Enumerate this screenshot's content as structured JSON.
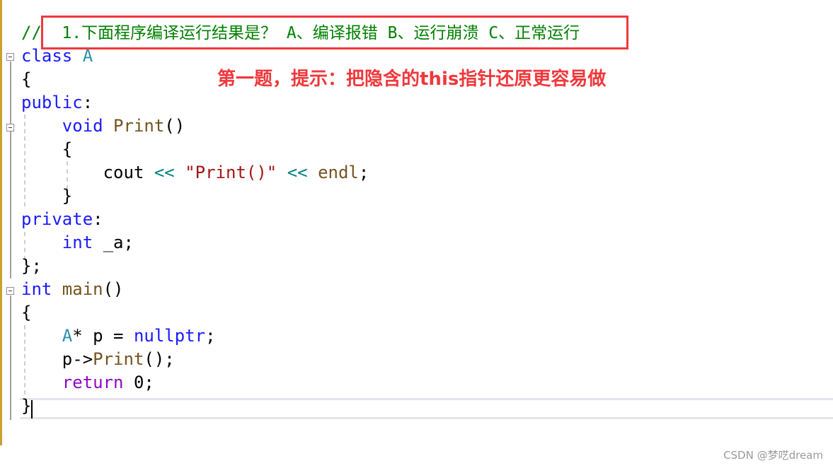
{
  "code": {
    "lines": [
      [
        [
          "// ",
          "cm"
        ],
        [
          "1.下面程序编译运行结果是？ A、编译报错 B、运行崩溃 C、正常运行",
          "cm"
        ]
      ],
      [
        [
          "class ",
          "kw"
        ],
        [
          "A",
          "ty"
        ]
      ],
      [
        [
          "{",
          "pl"
        ]
      ],
      [
        [
          "public",
          "kw"
        ],
        [
          ":",
          "pl"
        ]
      ],
      [
        [
          "    ",
          "pl"
        ],
        [
          "void ",
          "kw"
        ],
        [
          "Print",
          "fn"
        ],
        [
          "()",
          "pl"
        ]
      ],
      [
        [
          "    {",
          "pl"
        ]
      ],
      [
        [
          "        cout ",
          "pl"
        ],
        [
          "<<",
          "op"
        ],
        [
          " ",
          "pl"
        ],
        [
          "\"Print()\"",
          "str"
        ],
        [
          " ",
          "pl"
        ],
        [
          "<<",
          "op"
        ],
        [
          " ",
          "pl"
        ],
        [
          "endl",
          "fn"
        ],
        [
          ";",
          "pl"
        ]
      ],
      [
        [
          "    }",
          "pl"
        ]
      ],
      [
        [
          "private",
          "kw"
        ],
        [
          ":",
          "pl"
        ]
      ],
      [
        [
          "    ",
          "pl"
        ],
        [
          "int ",
          "kw"
        ],
        [
          "_a;",
          "pl"
        ]
      ],
      [
        [
          "};",
          "pl"
        ]
      ],
      [
        [
          "int ",
          "kw"
        ],
        [
          "main",
          "fn"
        ],
        [
          "()",
          "pl"
        ]
      ],
      [
        [
          "{",
          "pl"
        ]
      ],
      [
        [
          "    ",
          "pl"
        ],
        [
          "A",
          "ty"
        ],
        [
          "* p = ",
          "pl"
        ],
        [
          "nullptr",
          "kw"
        ],
        [
          ";",
          "pl"
        ]
      ],
      [
        [
          "    p->",
          "pl"
        ],
        [
          "Print",
          "fn"
        ],
        [
          "();",
          "pl"
        ]
      ],
      [
        [
          "    ",
          "pl"
        ],
        [
          "return ",
          "ret"
        ],
        [
          "0;",
          "pl"
        ]
      ],
      [
        [
          "}",
          "pl"
        ]
      ]
    ]
  },
  "annotation": {
    "hint": "第一题，提示：把隐含的this指针还原更容易做"
  },
  "watermark": "CSDN @梦呓dream",
  "colors": {
    "highlight_box": "#f0383c",
    "comment": "#008000",
    "keyword": "#1a1aff"
  }
}
